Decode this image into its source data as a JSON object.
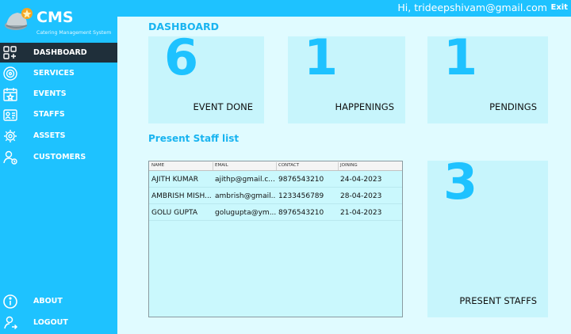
{
  "header": {
    "greeting": "Hi, trideepshivam@gmail.com",
    "exit_label": "Exit"
  },
  "brand": {
    "title": "CMS",
    "subtitle": "Catering Management System"
  },
  "sidebar": {
    "items": [
      {
        "label": "DASHBOARD",
        "icon": "dashboard-icon",
        "active": true
      },
      {
        "label": "SERVICES",
        "icon": "services-icon"
      },
      {
        "label": "EVENTS",
        "icon": "calendar-icon"
      },
      {
        "label": "STAFFS",
        "icon": "staff-icon"
      },
      {
        "label": "ASSETS",
        "icon": "assets-icon"
      },
      {
        "label": "CUSTOMERS",
        "icon": "customers-icon"
      }
    ],
    "bottom_items": [
      {
        "label": "ABOUT",
        "icon": "info-icon"
      },
      {
        "label": "LOGOUT",
        "icon": "logout-icon"
      }
    ]
  },
  "page_title": "DASHBOARD",
  "stats": [
    {
      "value": "6",
      "label": "EVENT DONE"
    },
    {
      "value": "1",
      "label": "HAPPENINGS"
    },
    {
      "value": "1",
      "label": "PENDINGS"
    },
    {
      "value": "3",
      "label": "PRESENT STAFFS"
    }
  ],
  "staff_list": {
    "title": "Present Staff list",
    "columns": [
      "NAME",
      "EMAIL",
      "CONTACT",
      "JOINING"
    ],
    "rows": [
      [
        "AJITH KUMAR",
        "ajithp@gmail.c...",
        "9876543210",
        "24-04-2023"
      ],
      [
        "AMBRISH MISH...",
        "ambrish@gmail...",
        "1233456789",
        "28-04-2023"
      ],
      [
        "GOLU GUPTA",
        "golugupta@ym...",
        "8976543210",
        "21-04-2023"
      ]
    ]
  },
  "colors": {
    "accent": "#1ec2ff",
    "sidebar_active": "#1f2f3a",
    "card_bg": "#c7f5fc",
    "page_bg": "#e0fbff",
    "title_color": "#19b4f0"
  }
}
